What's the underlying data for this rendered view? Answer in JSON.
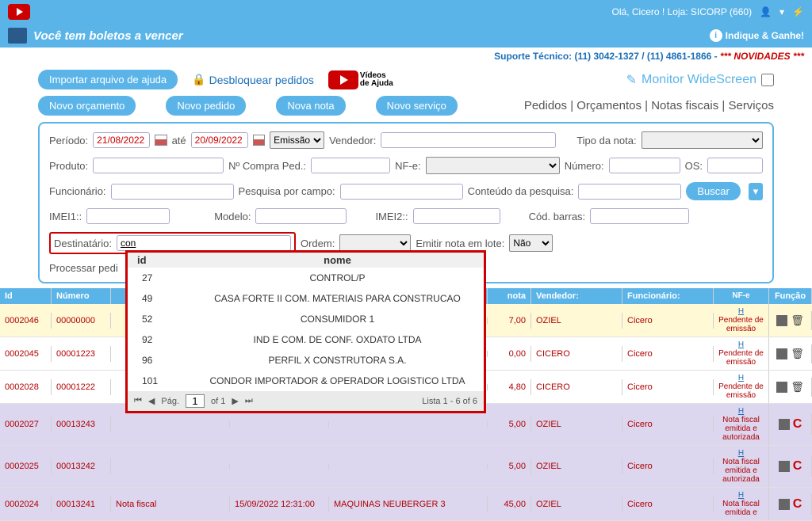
{
  "header": {
    "greeting": "Olá, Cicero !  Loja: SICORP (660)",
    "boletos": "Você tem boletos a vencer",
    "indique": "Indique & Ganhe!",
    "suporte_label": "Suporte Técnico: ",
    "suporte_phones": "(11) 3042-1327 / (11) 4861-1866 - ",
    "novidades": "*** NOVIDADES ***"
  },
  "toolbar": {
    "importar": "Importar arquivo de ajuda",
    "desbloquear": "Desbloquear pedidos",
    "videos_line1": "Vídeos",
    "videos_line2": "de Ajuda",
    "monitor": "Monitor WideScreen"
  },
  "nav": {
    "novo_orcamento": "Novo orçamento",
    "novo_pedido": "Novo pedido",
    "nova_nota": "Nova nota",
    "novo_servico": "Novo serviço",
    "pedidos": "Pedidos",
    "orcamentos": "Orçamentos",
    "notas": "Notas fiscais",
    "servicos": "Serviços"
  },
  "filters": {
    "periodo": "Período:",
    "data_de": "21/08/2022",
    "ate": "até",
    "data_ate": "20/09/2022",
    "emissao": "Emissão",
    "vendedor": "Vendedor:",
    "tipo_nota": "Tipo da nota:",
    "produto": "Produto:",
    "n_compra": "Nº Compra Ped.:",
    "nfe": "NF-e:",
    "numero": "Número:",
    "os": "OS:",
    "funcionario": "Funcionário:",
    "pesq_campo": "Pesquisa por campo:",
    "conteudo": "Conteúdo da pesquisa:",
    "buscar": "Buscar",
    "imei1": "IMEI1::",
    "modelo": "Modelo:",
    "imei2": "IMEI2::",
    "cod_barras": "Cód. barras:",
    "destinatario": "Destinatário:",
    "dest_value": "con",
    "ordem": "Ordem:",
    "emitir_lote": "Emitir nota em lote:",
    "nao": "Não",
    "processar": "Processar pedi"
  },
  "popup": {
    "hdr_id": "id",
    "hdr_nome": "nome",
    "rows": [
      {
        "id": "27",
        "nome": "CONTROL/P"
      },
      {
        "id": "49",
        "nome": "CASA FORTE II COM. MATERIAIS PARA CONSTRUCAO"
      },
      {
        "id": "52",
        "nome": "CONSUMIDOR 1"
      },
      {
        "id": "92",
        "nome": "IND E COM. DE CONF. OXDATO LTDA"
      },
      {
        "id": "96",
        "nome": "PERFIL X CONSTRUTORA S.A."
      },
      {
        "id": "101",
        "nome": "CONDOR IMPORTADOR & OPERADOR LOGISTICO LTDA"
      }
    ],
    "pag_label": "Pág.",
    "pag_num": "1",
    "pag_of": "of 1",
    "lista": "Lista 1 - 6 of 6"
  },
  "grid": {
    "headers": {
      "id": "Id",
      "numero": "Número",
      "nota": "nota",
      "vendedor": "Vendedor:",
      "funcionario": "Funcionário:",
      "nfe": "NF-e",
      "funcao": "Função"
    },
    "rows": [
      {
        "id": "0002046",
        "num": "00000000",
        "sit": "",
        "data": "",
        "dest": "",
        "val": "7,00",
        "vend": "OZIEL",
        "func": "Cicero",
        "nfe": "Pendente de emissão",
        "cls": "row-yellow",
        "act": "trash"
      },
      {
        "id": "0002045",
        "num": "00001223",
        "sit": "",
        "data": "",
        "dest": "",
        "val": "0,00",
        "vend": "CICERO",
        "func": "Cicero",
        "nfe": "Pendente de emissão",
        "cls": "row-white",
        "act": "trash"
      },
      {
        "id": "0002028",
        "num": "00001222",
        "sit": "",
        "data": "",
        "dest": "",
        "val": "4,80",
        "vend": "CICERO",
        "func": "Cicero",
        "nfe": "Pendente de emissão",
        "cls": "row-white",
        "act": "trash"
      },
      {
        "id": "0002027",
        "num": "00013243",
        "sit": "",
        "data": "",
        "dest": "",
        "val": "5,00",
        "vend": "OZIEL",
        "func": "Cicero",
        "nfe": "Nota fiscal emitida e autorizada",
        "cls": "row-purple",
        "act": "c"
      },
      {
        "id": "0002025",
        "num": "00013242",
        "sit": "",
        "data": "",
        "dest": "",
        "val": "5,00",
        "vend": "OZIEL",
        "func": "Cicero",
        "nfe": "Nota fiscal emitida e autorizada",
        "cls": "row-purple",
        "act": "c"
      },
      {
        "id": "0002024",
        "num": "00013241",
        "sit": "Nota fiscal",
        "data": "15/09/2022 12:31:00",
        "dest": "MAQUINAS NEUBERGER 3",
        "val": "45,00",
        "vend": "OZIEL",
        "func": "Cicero",
        "nfe": "Nota fiscal emitida e",
        "cls": "row-purple",
        "act": "c"
      }
    ],
    "h_link": "H"
  }
}
